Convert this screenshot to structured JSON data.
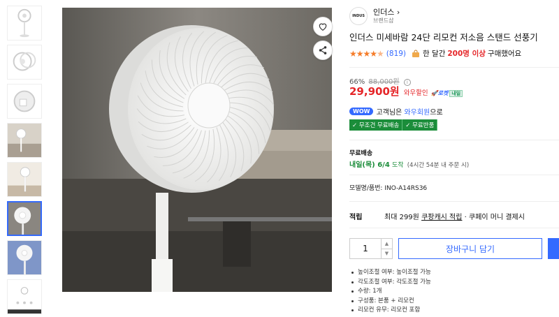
{
  "brand": {
    "logo_text": "INDUS",
    "name": "인더스",
    "chevron": "›",
    "subtitle": "브랜드샵"
  },
  "product": {
    "title": "인더스 미세바람 24단 리모컨 저소음 스탠드 선풍기",
    "rating_stars": 4.5,
    "review_count": "(819)",
    "purchase_prefix": "한 달간",
    "purchase_count": "200명 이상",
    "purchase_suffix": "구매했어요"
  },
  "price": {
    "discount_rate": "66%",
    "original": "88,000원",
    "current": "29,900원",
    "tag": "와우할인",
    "rocket_label": "로켓",
    "rocket_day": "내일"
  },
  "wow": {
    "badge": "WOW",
    "text_prefix": "고객님은",
    "link": "와우회원",
    "text_suffix": "으로"
  },
  "free_tags": [
    "✓ 무조건 무료배송",
    "✓ 무료반품"
  ],
  "shipping": {
    "label": "무료배송",
    "date": "내일(목) 6/4",
    "arrive": "도착",
    "note": "(4시간 54분 내 주문 시)"
  },
  "model": {
    "label": "모델명/품번:",
    "value": "INO-A14RS36"
  },
  "points": {
    "label": "적립",
    "prefix": "최대 299원",
    "link": "쿠팡캐시 적립",
    "suffix": "· 쿠페이 머니 결제시"
  },
  "purchase": {
    "quantity": "1",
    "cart_label": "장바구니 담기"
  },
  "specs": [
    "높이조절 여부: 높이조절 가능",
    "각도조절 여부: 각도조절 가능",
    "수량: 1개",
    "구성품: 본품 + 리모컨",
    "리모컨 유무: 리모컨 포함"
  ],
  "colors": {
    "accent": "#346aff",
    "price_red": "#e52528",
    "rocket_green": "#1b8d3a",
    "star_orange": "#f57c29"
  },
  "icons": {
    "wishlist": "heart-icon",
    "share": "share-icon",
    "qty_up": "chevron-up-icon",
    "qty_down": "chevron-down-icon"
  }
}
